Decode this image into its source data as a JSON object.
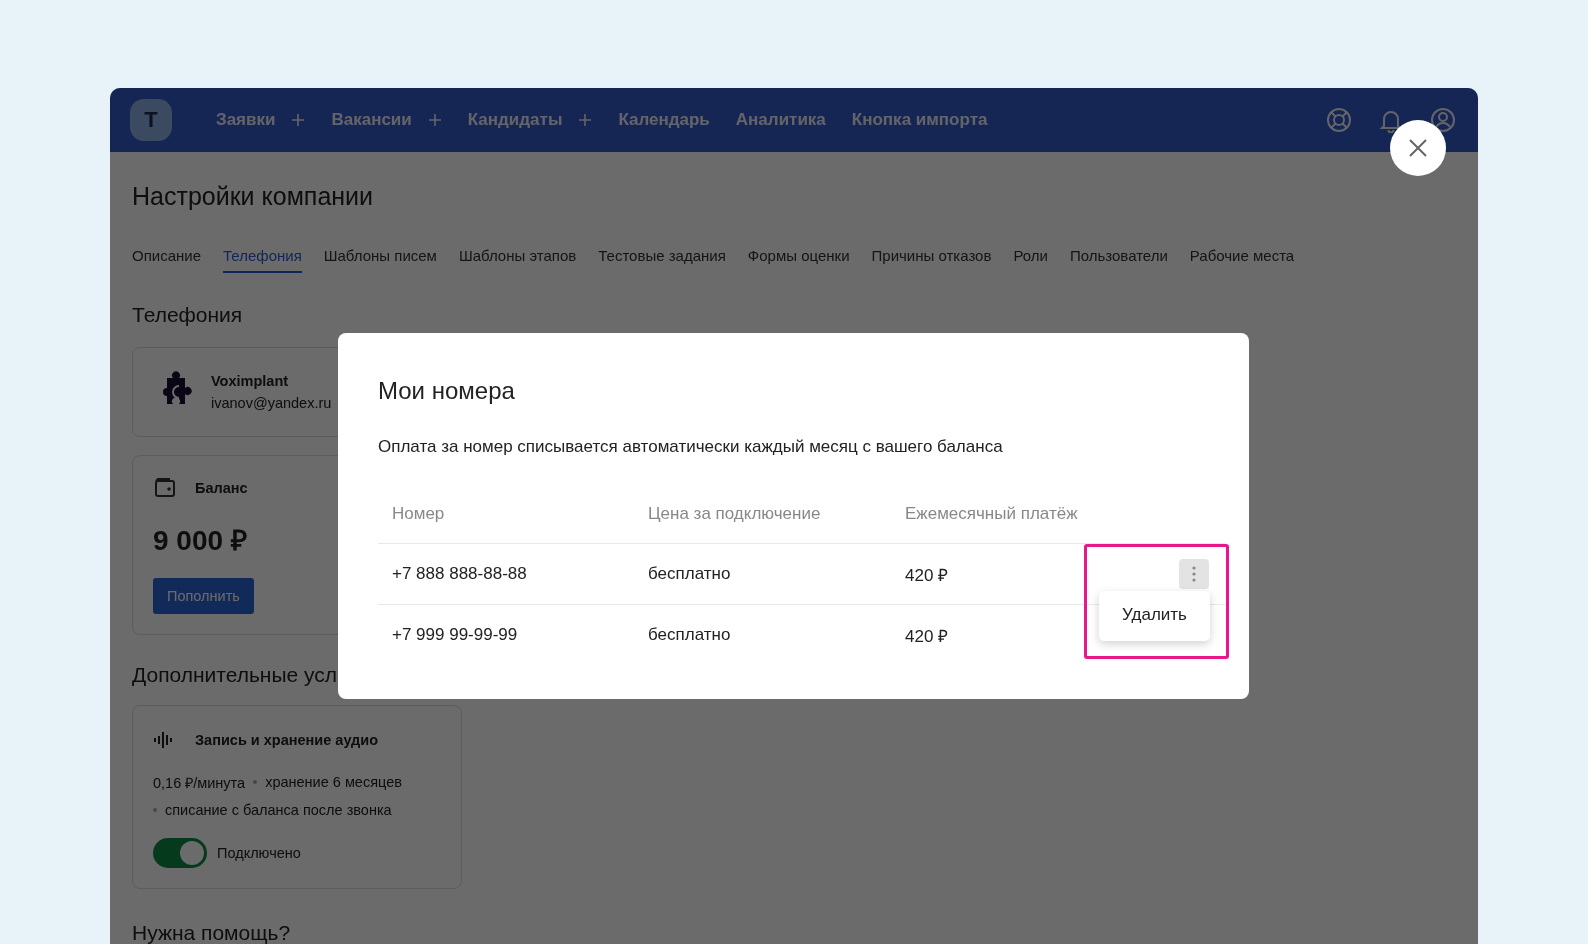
{
  "nav": {
    "items": [
      {
        "label": "Заявки",
        "has_add": true
      },
      {
        "label": "Вакансии",
        "has_add": true
      },
      {
        "label": "Кандидаты",
        "has_add": true
      },
      {
        "label": "Календарь",
        "has_add": false
      },
      {
        "label": "Аналитика",
        "has_add": false
      },
      {
        "label": "Кнопка импорта",
        "has_add": false
      }
    ],
    "logo": "T"
  },
  "page": {
    "title": "Настройки компании",
    "tabs": [
      {
        "label": "Описание",
        "selected": false
      },
      {
        "label": "Телефония",
        "selected": true
      },
      {
        "label": "Шаблоны писем",
        "selected": false
      },
      {
        "label": "Шаблоны этапов",
        "selected": false
      },
      {
        "label": "Тестовые задания",
        "selected": false
      },
      {
        "label": "Формы оценки",
        "selected": false
      },
      {
        "label": "Причины отказов",
        "selected": false
      },
      {
        "label": "Роли",
        "selected": false
      },
      {
        "label": "Пользователи",
        "selected": false
      },
      {
        "label": "Рабочие места",
        "selected": false
      }
    ],
    "section_title": "Телефония",
    "provider": {
      "name": "Voximplant",
      "account": "ivanov@yandex.ru"
    },
    "balance": {
      "label": "Баланс",
      "amount": "9 000 ₽",
      "button": "Пополнить"
    },
    "extras_title": "Дополнительные усл",
    "audio": {
      "title": "Запись и хранение аудио",
      "facts": [
        "0,16 ₽/минута",
        "хранение 6 месяцев",
        "списание с баланса после звонка"
      ],
      "on": true,
      "status": "Подключено"
    },
    "help_title": "Нужна помощь?"
  },
  "modal": {
    "title": "Мои номера",
    "description": "Оплата за номер списывается автоматически каждый месяц с вашего баланса",
    "columns": [
      "Номер",
      "Цена за подключение",
      "Ежемесячный платёж"
    ],
    "rows": [
      {
        "number": "+7 888 888-88-88",
        "price": "бесплатно",
        "monthly": "420 ₽",
        "menu_open": true,
        "menu_items": [
          "Удалить"
        ],
        "highlighted": true
      },
      {
        "number": "+7 999 99-99-99",
        "price": "бесплатно",
        "monthly": "420 ₽",
        "menu_open": false
      }
    ]
  }
}
